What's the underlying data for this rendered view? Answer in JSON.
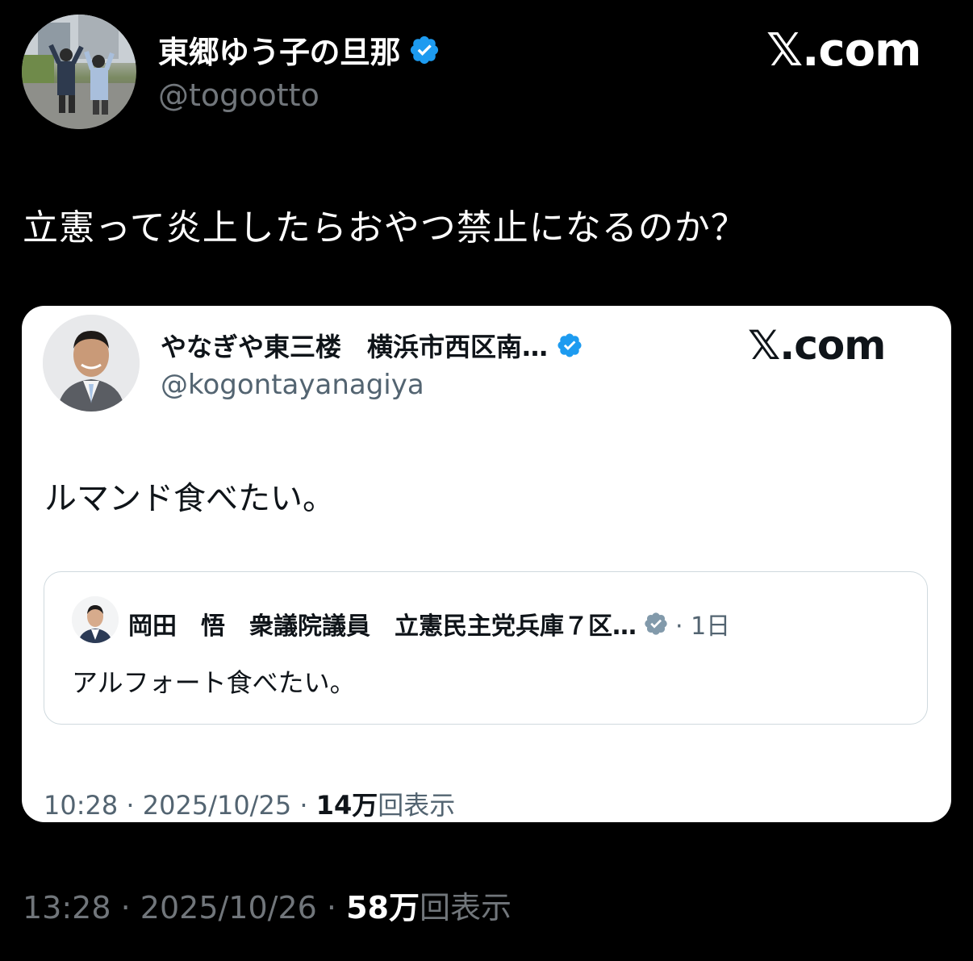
{
  "outer_tweet": {
    "author_name": "東郷ゆう子の旦那",
    "author_handle": "@togootto",
    "verified_badge": "verified-badge-blue",
    "site_logo": "𝕏.com",
    "text": "立憲って炎上したらおやつ禁止になるのか？",
    "time": "13:28",
    "date": "2025/10/26",
    "views_count": "58万",
    "views_label": "回表示",
    "separator": "·"
  },
  "quoted_tweet": {
    "author_name": "やなぎや東三楼　横浜市西区南…",
    "author_handle": "@kogontayanagiya",
    "verified_badge": "verified-badge-blue",
    "site_logo": "𝕏.com",
    "text": "ルマンド食べたい。",
    "time": "10:28",
    "date": "2025/10/25",
    "views_count": "14万",
    "views_label": "回表示",
    "separator": "·"
  },
  "nested_quote": {
    "author_name": "岡田　悟　衆議院議員　立憲民主党兵庫７区…",
    "verified_badge": "verified-badge-gray",
    "relative_date": "· 1日",
    "text": "アルフォート食べたい。"
  },
  "colors": {
    "background": "#000000",
    "secondary_text_dark": "#71767b",
    "secondary_text_light": "#536471",
    "verified_blue": "#1d9bf0",
    "verified_gray": "#829aab",
    "card_border": "#cfd9de"
  }
}
